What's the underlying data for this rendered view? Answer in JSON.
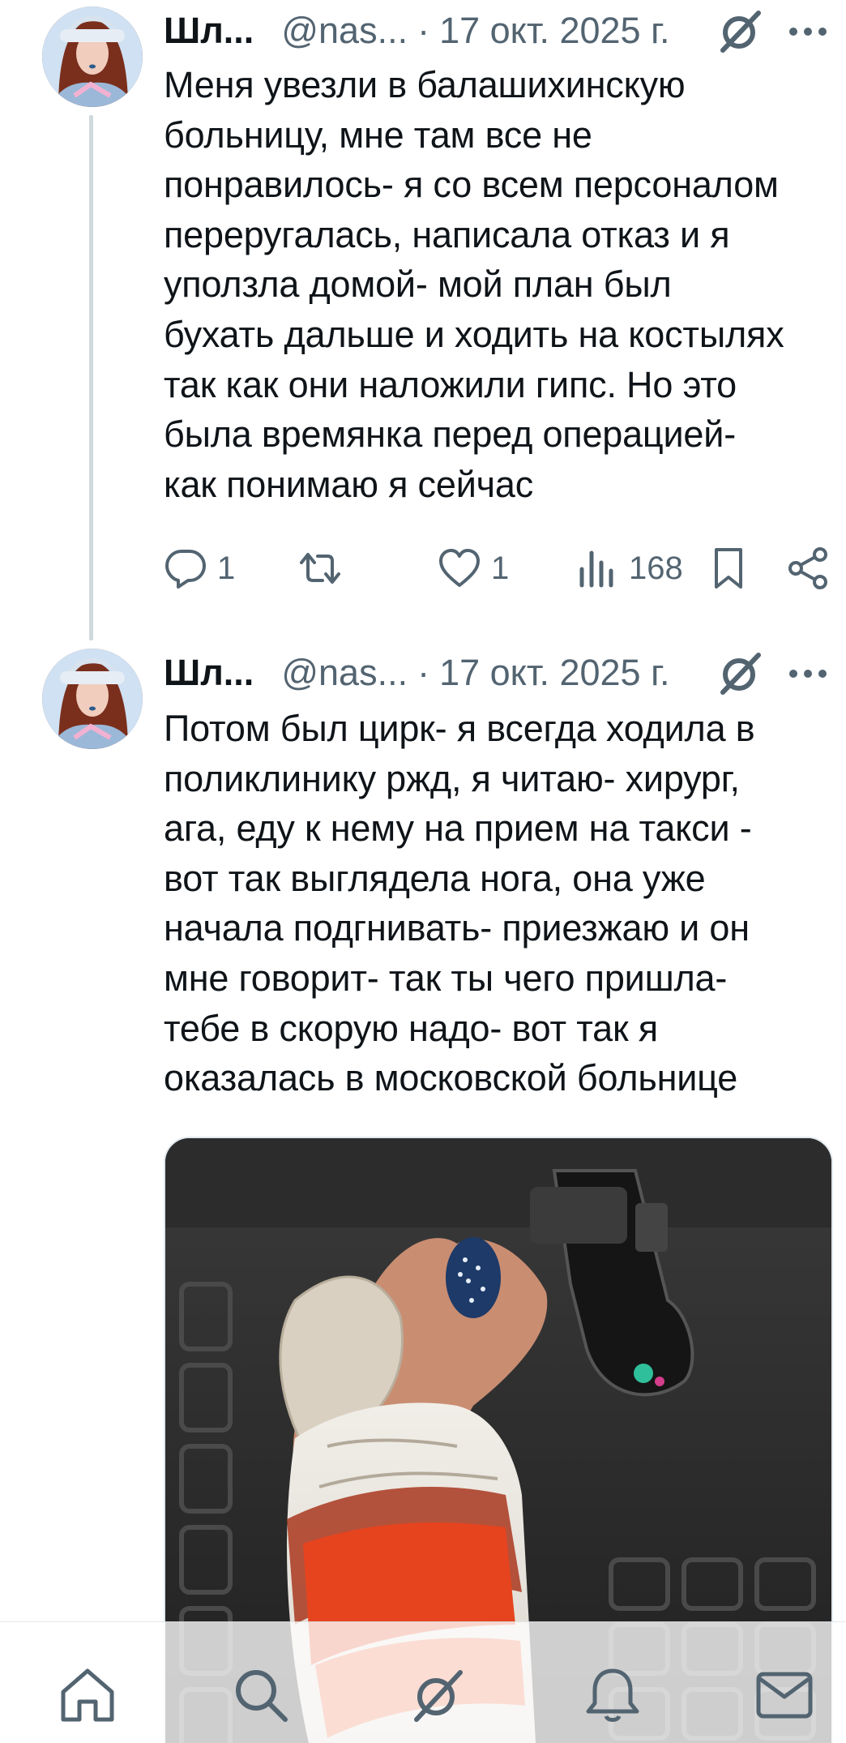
{
  "tweets": [
    {
      "name": "Шл...",
      "handle": "@nas...",
      "separator": "·",
      "date": "17 окт. 2025 г.",
      "text": "Меня увезли в балашихинскую\nбольницу, мне там все не\nпонравилось- я со всем персоналом\nпереругалась, написала отказ и я\nуползла домой- мой план был\nбухать дальше и ходить на костылях\nтак как они наложили гипс. Но это\nбыла времянка перед операцией-\nкак понимаю я сейчас",
      "actions": {
        "replies": "1",
        "likes": "1",
        "views": "168"
      }
    },
    {
      "name": "Шл...",
      "handle": "@nas...",
      "separator": "·",
      "date": "17 окт. 2025 г.",
      "text": "Потом был цирк- я всегда ходила в\nполиклинику ржд, я читаю- хирург,\nага, еду к нему на прием на такси -\nвот так выглядела нога, она уже\nначала подгнивать- приезжаю и он\nмне говорит- так ты чего пришла-\nтебе в скорую надо- вот так я\nоказалась в московской больнице"
    }
  ],
  "icons": {
    "grok": "grok-icon",
    "more": "more-icon",
    "reply": "reply-icon",
    "retweet": "retweet-icon",
    "like": "heart-icon",
    "views": "views-icon",
    "bookmark": "bookmark-icon",
    "share": "share-icon"
  },
  "bottom_nav": [
    "home-icon",
    "search-icon",
    "grok-icon",
    "notifications-icon",
    "messages-icon"
  ],
  "colors": {
    "text": "#0f1419",
    "secondary": "#536471",
    "thread_line": "#cfd9de"
  }
}
